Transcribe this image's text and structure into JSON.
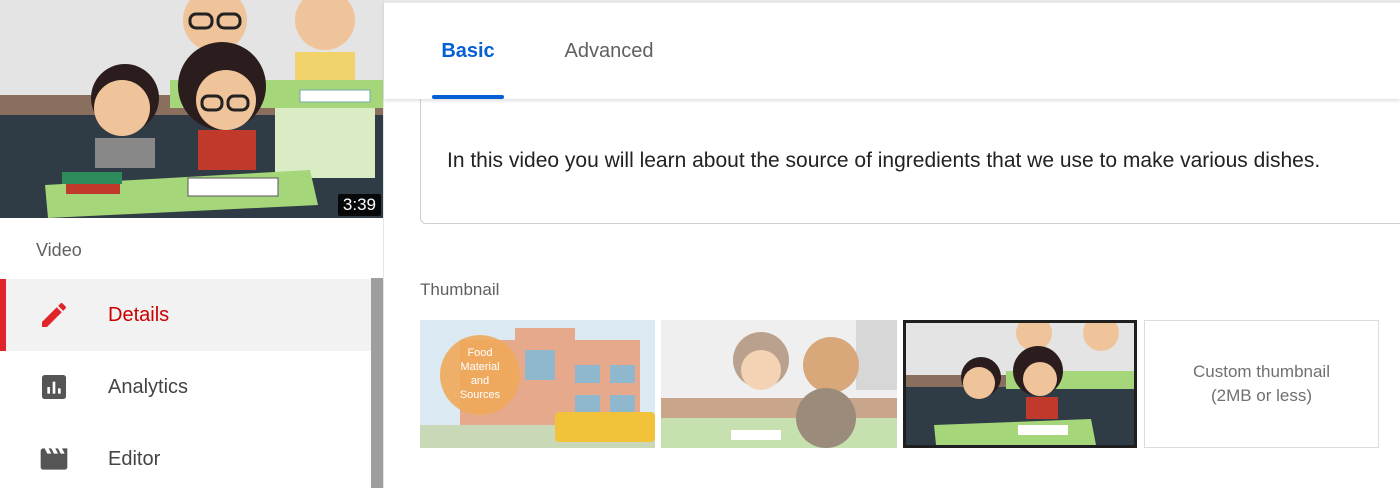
{
  "sidebar": {
    "video_duration": "3:39",
    "section_label": "Video",
    "items": [
      {
        "label": "Details",
        "icon": "pencil-icon",
        "active": true
      },
      {
        "label": "Analytics",
        "icon": "bar-chart-icon",
        "active": false
      },
      {
        "label": "Editor",
        "icon": "clapperboard-icon",
        "active": false
      }
    ]
  },
  "tabs": [
    {
      "label": "Basic",
      "active": true
    },
    {
      "label": "Advanced",
      "active": false
    }
  ],
  "description": {
    "text": "In this video you will learn about the source of ingredients that we use to make various dishes."
  },
  "thumbnail": {
    "label": "Thumbnail",
    "options": [
      {
        "name": "thumbnail-option-1",
        "caption_lines": [
          "Food",
          "Material",
          "and",
          "Sources"
        ],
        "selected": false
      },
      {
        "name": "thumbnail-option-2",
        "selected": false
      },
      {
        "name": "thumbnail-option-3",
        "selected": true
      }
    ],
    "custom_line1": "Custom thumbnail",
    "custom_line2": "(2MB or less)"
  },
  "colors": {
    "accent_red": "#e0242a",
    "accent_blue": "#065fd4"
  }
}
